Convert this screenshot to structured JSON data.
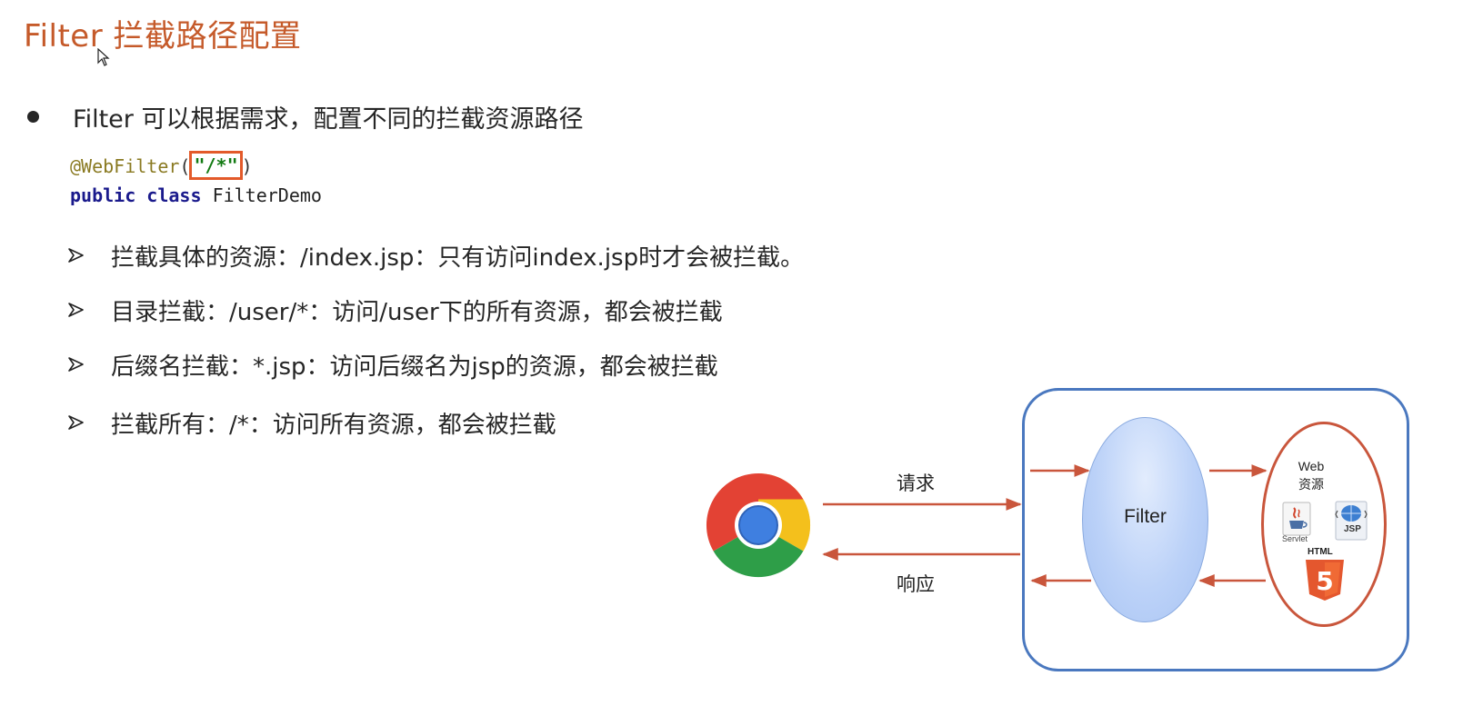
{
  "slide": {
    "title": "Filter 拦截路径配置",
    "bullet": "Filter 可以根据需求，配置不同的拦截资源路径",
    "code": {
      "annotation": "@WebFilter",
      "open_paren": "(",
      "string_value": "\"/*\"",
      "close_paren": ")",
      "keyword_public": "public",
      "keyword_class": "class",
      "class_name": "FilterDemo"
    },
    "sub_items": [
      "拦截具体的资源：/index.jsp：只有访问index.jsp时才会被拦截。",
      "目录拦截：/user/*：访问/user下的所有资源，都会被拦截",
      "后缀名拦截：*.jsp：访问后缀名为jsp的资源，都会被拦截",
      "拦截所有：/*：访问所有资源，都会被拦截"
    ]
  },
  "diagram": {
    "request_label": "请求",
    "response_label": "响应",
    "filter_label": "Filter",
    "web_label_line1": "Web",
    "web_label_line2": "资源",
    "servlet_caption": "Servlet",
    "jsp_caption": "JSP",
    "html_caption": "HTML",
    "html_badge": "5",
    "colors": {
      "title": "#c55a2a",
      "box_border": "#4a78bf",
      "arrow": "#c9563c",
      "highlight_box": "#e35a2a"
    },
    "icons": [
      "chrome-icon",
      "servlet-icon",
      "jsp-icon",
      "html5-icon"
    ]
  }
}
